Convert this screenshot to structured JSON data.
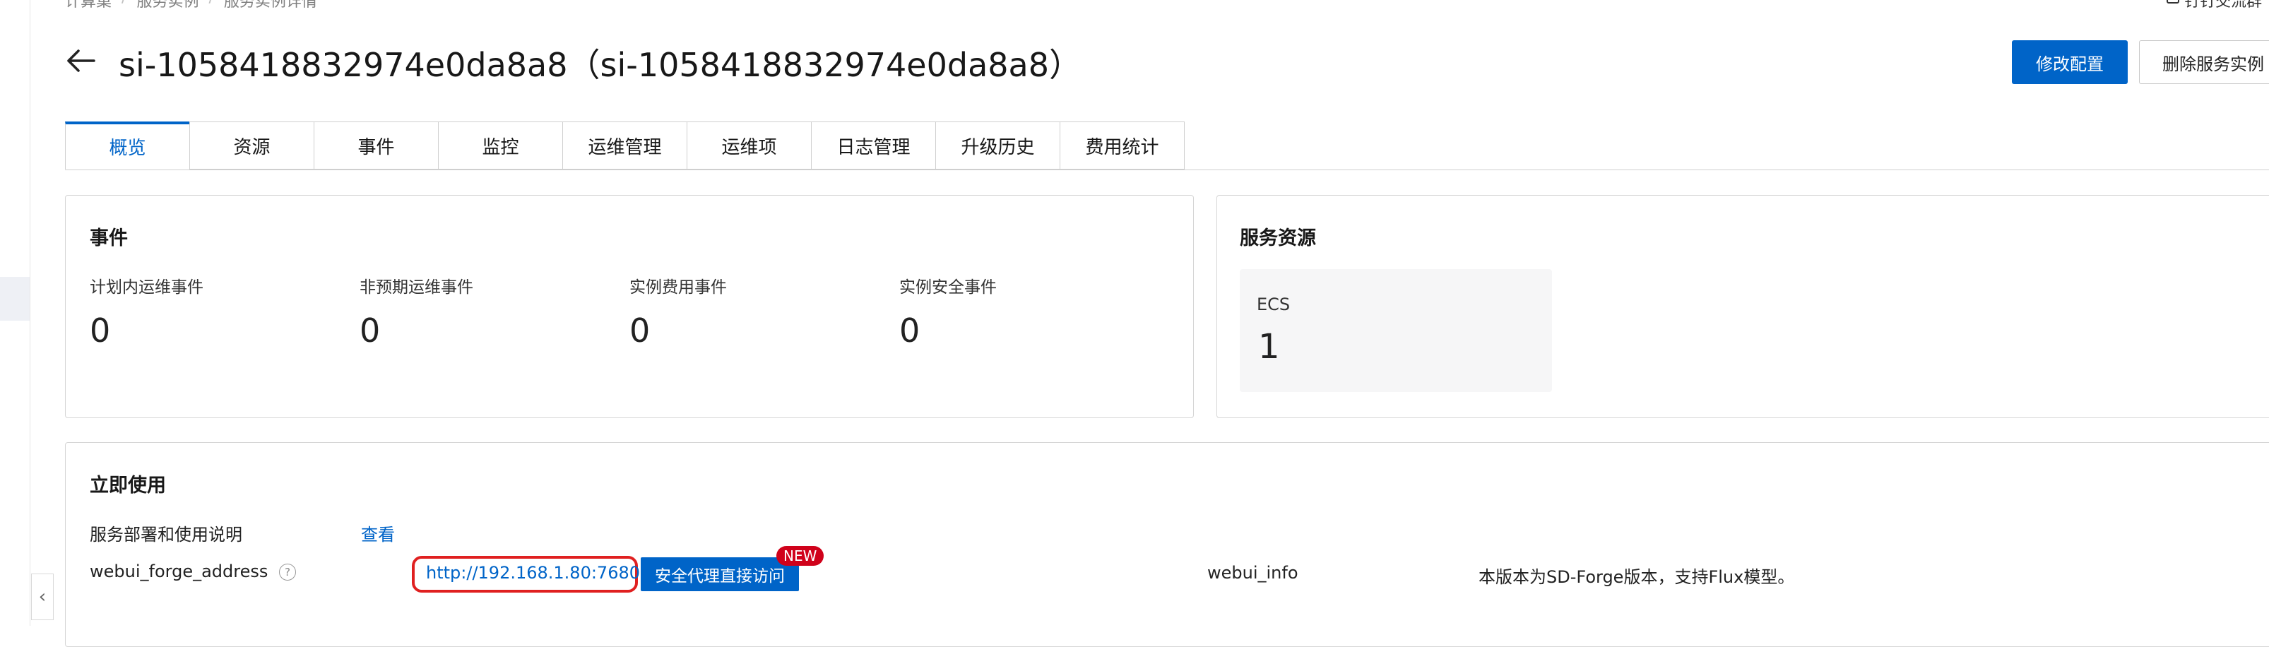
{
  "breadcrumb": {
    "items": [
      "计算巢",
      "服务实例",
      "服务实例详情"
    ],
    "separator": "/"
  },
  "top_link": {
    "icon": "dingtalk-icon",
    "label": "钉钉交流群"
  },
  "header": {
    "title": "si-1058418832974e0da8a8（si-1058418832974e0da8a8）",
    "back_icon": "arrow-left-icon",
    "edit_button": "修改配置",
    "delete_button": "删除服务实例"
  },
  "tabs": [
    {
      "label": "概览",
      "active": true
    },
    {
      "label": "资源",
      "active": false
    },
    {
      "label": "事件",
      "active": false
    },
    {
      "label": "监控",
      "active": false
    },
    {
      "label": "运维管理",
      "active": false
    },
    {
      "label": "运维项",
      "active": false
    },
    {
      "label": "日志管理",
      "active": false
    },
    {
      "label": "升级历史",
      "active": false
    },
    {
      "label": "费用统计",
      "active": false
    }
  ],
  "events": {
    "title": "事件",
    "items": [
      {
        "label": "计划内运维事件",
        "value": "0"
      },
      {
        "label": "非预期运维事件",
        "value": "0"
      },
      {
        "label": "实例费用事件",
        "value": "0"
      },
      {
        "label": "实例安全事件",
        "value": "0"
      }
    ]
  },
  "resources": {
    "title": "服务资源",
    "ecs_label": "ECS",
    "ecs_value": "1"
  },
  "use": {
    "title": "立即使用",
    "doc_label": "服务部署和使用说明",
    "doc_link": "查看",
    "address_label": "webui_forge_address",
    "address_value": "http://192.168.1.80:7680",
    "proxy_button": "安全代理直接访问",
    "new_badge": "NEW",
    "info_label": "webui_info",
    "info_value": "本版本为SD-Forge版本，支持Flux模型。"
  },
  "colors": {
    "primary": "#0064c8",
    "highlight_border": "#e02020",
    "badge": "#d0021b"
  },
  "sidebar": {
    "collapse_icon": "chevron-left-icon"
  }
}
